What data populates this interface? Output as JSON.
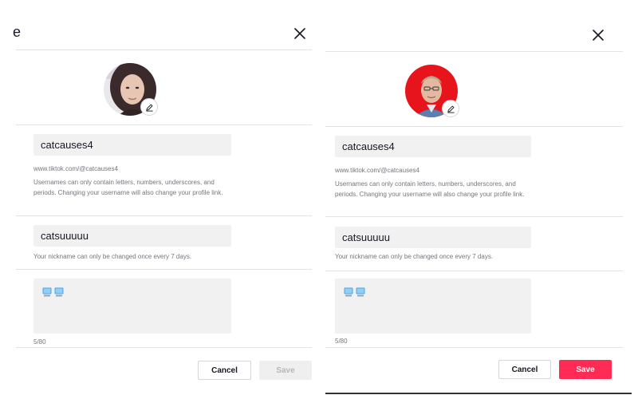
{
  "left_panel": {
    "title": "e",
    "avatar": {
      "description": "user profile photo"
    },
    "username": {
      "value": "catcauses4"
    },
    "profile_link": "www.tiktok.com/@catcauses4",
    "username_hint": "Usernames can only contain letters, numbers, underscores, and periods. Changing your username will also change your profile link.",
    "nickname": {
      "value": "catsuuuuu"
    },
    "nickname_hint": "Your nickname can only be changed once every 7 days.",
    "bio": {
      "content_icons": [
        "computer-icon",
        "computer-icon"
      ]
    },
    "bio_counter": "5/80",
    "cancel_label": "Cancel",
    "save_label": "Save",
    "save_state": "disabled"
  },
  "right_panel": {
    "avatar": {
      "description": "user profile photo on red background"
    },
    "username": {
      "value": "catcauses4"
    },
    "profile_link": "www.tiktok.com/@catcauses4",
    "username_hint": "Usernames can only contain letters, numbers, underscores, and periods. Changing your username will also change your profile link.",
    "nickname": {
      "value": "catsuuuuu"
    },
    "nickname_hint": "Your nickname can only be changed once every 7 days.",
    "bio": {
      "content_icons": [
        "computer-icon",
        "computer-icon"
      ]
    },
    "bio_counter": "5/80",
    "cancel_label": "Cancel",
    "save_label": "Save",
    "save_state": "active"
  },
  "colors": {
    "accent": "#fe2c55",
    "input_bg": "#f1f1f2",
    "hint_text": "#75767d",
    "divider": "#e3e3e4"
  }
}
